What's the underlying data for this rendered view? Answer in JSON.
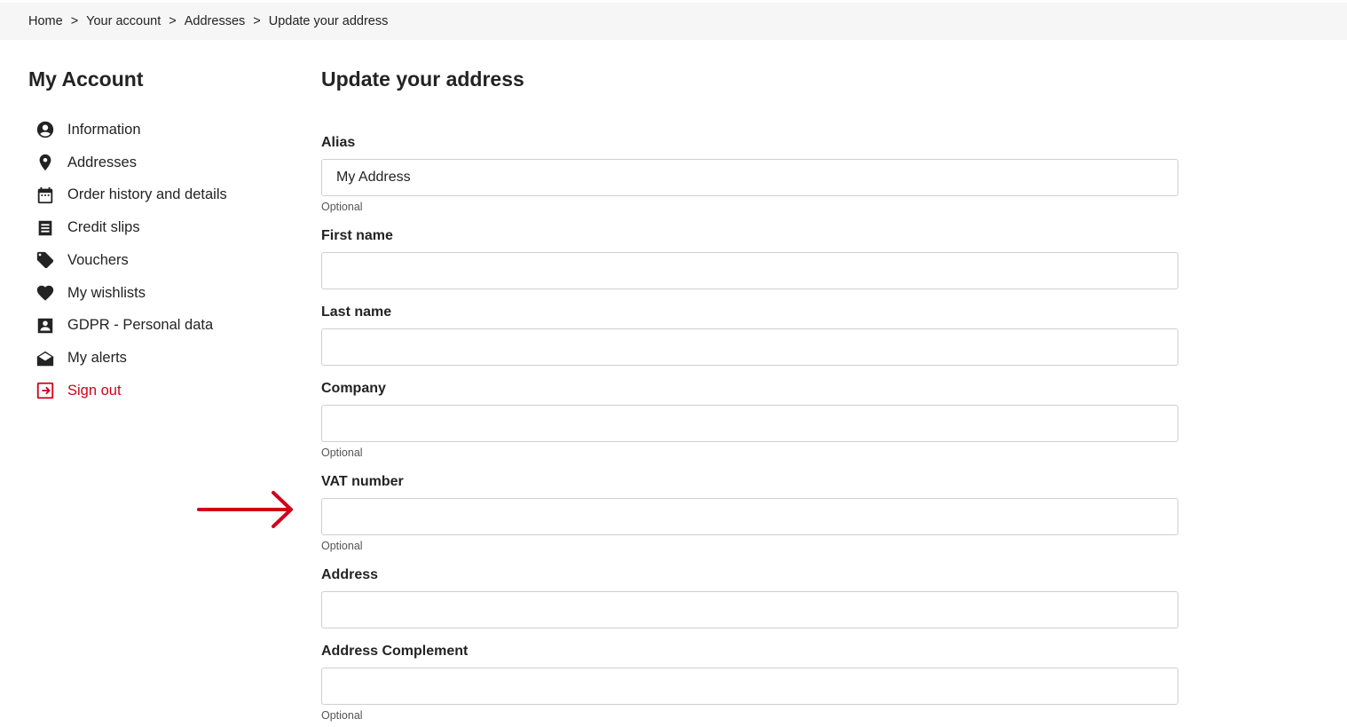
{
  "breadcrumb": {
    "items": [
      "Home",
      "Your account",
      "Addresses",
      "Update your address"
    ],
    "separator": ">"
  },
  "sidebar": {
    "title": "My Account",
    "items": [
      {
        "label": "Information",
        "icon": "user-circle-icon"
      },
      {
        "label": "Addresses",
        "icon": "map-pin-icon"
      },
      {
        "label": "Order history and details",
        "icon": "calendar-icon"
      },
      {
        "label": "Credit slips",
        "icon": "receipt-icon"
      },
      {
        "label": "Vouchers",
        "icon": "tag-icon"
      },
      {
        "label": "My wishlists",
        "icon": "heart-icon"
      },
      {
        "label": "GDPR - Personal data",
        "icon": "id-card-icon"
      },
      {
        "label": "My alerts",
        "icon": "envelope-open-icon"
      },
      {
        "label": "Sign out",
        "icon": "sign-out-icon",
        "color": "#d0021b"
      }
    ]
  },
  "main": {
    "title": "Update your address",
    "fields": [
      {
        "label": "Alias",
        "value": "My Address",
        "hint": "Optional"
      },
      {
        "label": "First name",
        "value": "",
        "hint": ""
      },
      {
        "label": "Last name",
        "value": "",
        "hint": ""
      },
      {
        "label": "Company",
        "value": "",
        "hint": "Optional"
      },
      {
        "label": "VAT number",
        "value": "",
        "hint": "Optional"
      },
      {
        "label": "Address",
        "value": "",
        "hint": ""
      },
      {
        "label": "Address Complement",
        "value": "",
        "hint": "Optional"
      }
    ]
  },
  "annotation": {
    "icon": "red-arrow-icon",
    "color": "#d0021b"
  },
  "colors": {
    "accent_red": "#d0021b",
    "breadcrumb_bg": "#f6f6f6",
    "text": "#232323"
  }
}
